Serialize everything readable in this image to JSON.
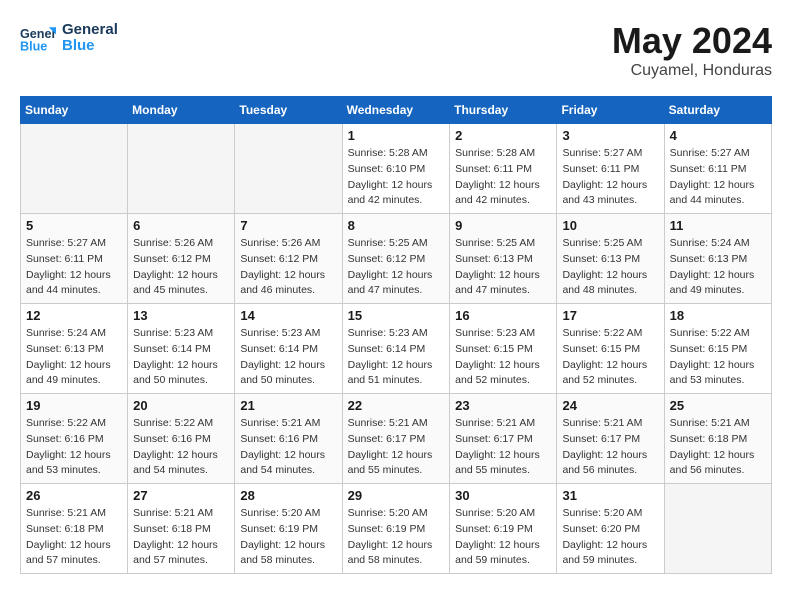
{
  "header": {
    "logo_line1": "General",
    "logo_line2": "Blue",
    "month": "May 2024",
    "location": "Cuyamel, Honduras"
  },
  "days_of_week": [
    "Sunday",
    "Monday",
    "Tuesday",
    "Wednesday",
    "Thursday",
    "Friday",
    "Saturday"
  ],
  "weeks": [
    [
      {
        "day": "",
        "info": ""
      },
      {
        "day": "",
        "info": ""
      },
      {
        "day": "",
        "info": ""
      },
      {
        "day": "1",
        "info": "Sunrise: 5:28 AM\nSunset: 6:10 PM\nDaylight: 12 hours\nand 42 minutes."
      },
      {
        "day": "2",
        "info": "Sunrise: 5:28 AM\nSunset: 6:11 PM\nDaylight: 12 hours\nand 42 minutes."
      },
      {
        "day": "3",
        "info": "Sunrise: 5:27 AM\nSunset: 6:11 PM\nDaylight: 12 hours\nand 43 minutes."
      },
      {
        "day": "4",
        "info": "Sunrise: 5:27 AM\nSunset: 6:11 PM\nDaylight: 12 hours\nand 44 minutes."
      }
    ],
    [
      {
        "day": "5",
        "info": "Sunrise: 5:27 AM\nSunset: 6:11 PM\nDaylight: 12 hours\nand 44 minutes."
      },
      {
        "day": "6",
        "info": "Sunrise: 5:26 AM\nSunset: 6:12 PM\nDaylight: 12 hours\nand 45 minutes."
      },
      {
        "day": "7",
        "info": "Sunrise: 5:26 AM\nSunset: 6:12 PM\nDaylight: 12 hours\nand 46 minutes."
      },
      {
        "day": "8",
        "info": "Sunrise: 5:25 AM\nSunset: 6:12 PM\nDaylight: 12 hours\nand 47 minutes."
      },
      {
        "day": "9",
        "info": "Sunrise: 5:25 AM\nSunset: 6:13 PM\nDaylight: 12 hours\nand 47 minutes."
      },
      {
        "day": "10",
        "info": "Sunrise: 5:25 AM\nSunset: 6:13 PM\nDaylight: 12 hours\nand 48 minutes."
      },
      {
        "day": "11",
        "info": "Sunrise: 5:24 AM\nSunset: 6:13 PM\nDaylight: 12 hours\nand 49 minutes."
      }
    ],
    [
      {
        "day": "12",
        "info": "Sunrise: 5:24 AM\nSunset: 6:13 PM\nDaylight: 12 hours\nand 49 minutes."
      },
      {
        "day": "13",
        "info": "Sunrise: 5:23 AM\nSunset: 6:14 PM\nDaylight: 12 hours\nand 50 minutes."
      },
      {
        "day": "14",
        "info": "Sunrise: 5:23 AM\nSunset: 6:14 PM\nDaylight: 12 hours\nand 50 minutes."
      },
      {
        "day": "15",
        "info": "Sunrise: 5:23 AM\nSunset: 6:14 PM\nDaylight: 12 hours\nand 51 minutes."
      },
      {
        "day": "16",
        "info": "Sunrise: 5:23 AM\nSunset: 6:15 PM\nDaylight: 12 hours\nand 52 minutes."
      },
      {
        "day": "17",
        "info": "Sunrise: 5:22 AM\nSunset: 6:15 PM\nDaylight: 12 hours\nand 52 minutes."
      },
      {
        "day": "18",
        "info": "Sunrise: 5:22 AM\nSunset: 6:15 PM\nDaylight: 12 hours\nand 53 minutes."
      }
    ],
    [
      {
        "day": "19",
        "info": "Sunrise: 5:22 AM\nSunset: 6:16 PM\nDaylight: 12 hours\nand 53 minutes."
      },
      {
        "day": "20",
        "info": "Sunrise: 5:22 AM\nSunset: 6:16 PM\nDaylight: 12 hours\nand 54 minutes."
      },
      {
        "day": "21",
        "info": "Sunrise: 5:21 AM\nSunset: 6:16 PM\nDaylight: 12 hours\nand 54 minutes."
      },
      {
        "day": "22",
        "info": "Sunrise: 5:21 AM\nSunset: 6:17 PM\nDaylight: 12 hours\nand 55 minutes."
      },
      {
        "day": "23",
        "info": "Sunrise: 5:21 AM\nSunset: 6:17 PM\nDaylight: 12 hours\nand 55 minutes."
      },
      {
        "day": "24",
        "info": "Sunrise: 5:21 AM\nSunset: 6:17 PM\nDaylight: 12 hours\nand 56 minutes."
      },
      {
        "day": "25",
        "info": "Sunrise: 5:21 AM\nSunset: 6:18 PM\nDaylight: 12 hours\nand 56 minutes."
      }
    ],
    [
      {
        "day": "26",
        "info": "Sunrise: 5:21 AM\nSunset: 6:18 PM\nDaylight: 12 hours\nand 57 minutes."
      },
      {
        "day": "27",
        "info": "Sunrise: 5:21 AM\nSunset: 6:18 PM\nDaylight: 12 hours\nand 57 minutes."
      },
      {
        "day": "28",
        "info": "Sunrise: 5:20 AM\nSunset: 6:19 PM\nDaylight: 12 hours\nand 58 minutes."
      },
      {
        "day": "29",
        "info": "Sunrise: 5:20 AM\nSunset: 6:19 PM\nDaylight: 12 hours\nand 58 minutes."
      },
      {
        "day": "30",
        "info": "Sunrise: 5:20 AM\nSunset: 6:19 PM\nDaylight: 12 hours\nand 59 minutes."
      },
      {
        "day": "31",
        "info": "Sunrise: 5:20 AM\nSunset: 6:20 PM\nDaylight: 12 hours\nand 59 minutes."
      },
      {
        "day": "",
        "info": ""
      }
    ]
  ]
}
